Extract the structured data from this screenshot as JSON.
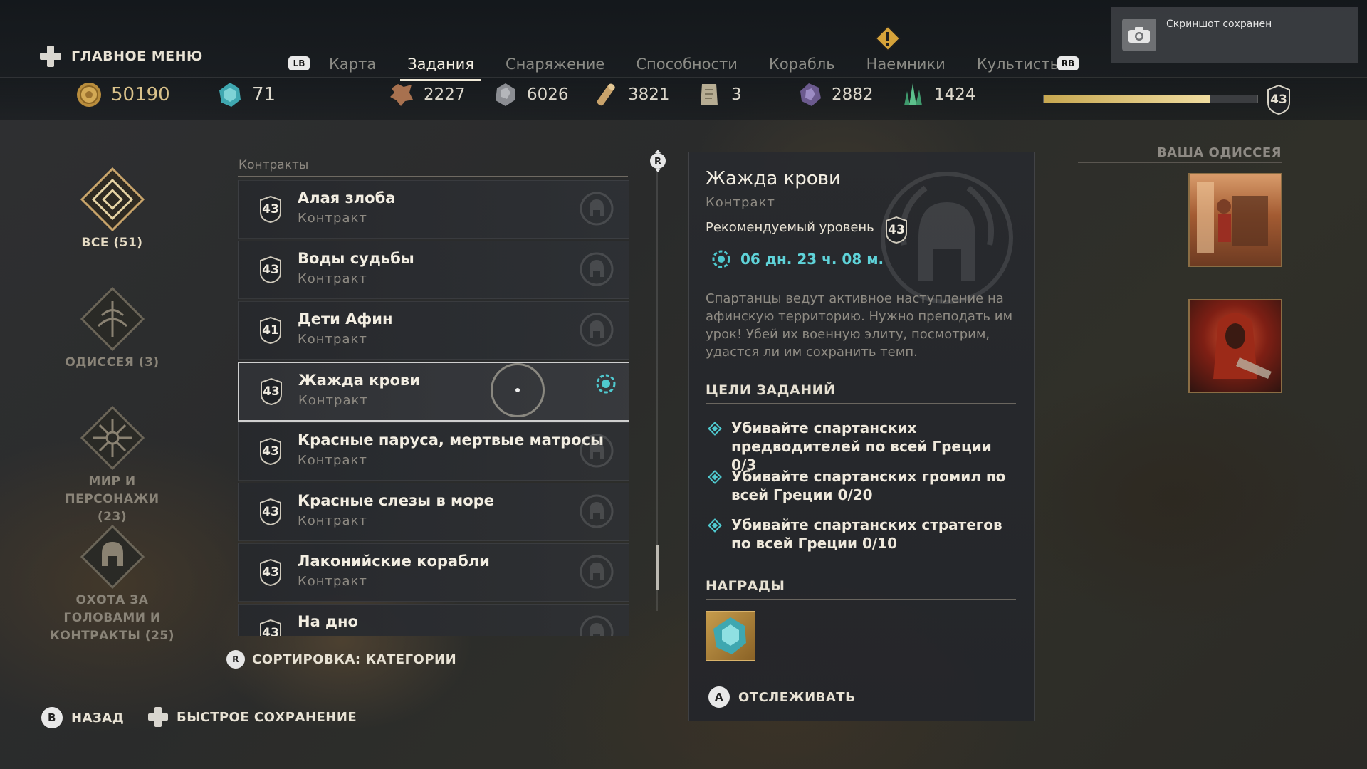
{
  "header": {
    "main_menu_label": "ГЛАВНОЕ МЕНЮ",
    "left_bumper": "LB",
    "right_bumper": "RB",
    "tabs": [
      {
        "label": "Карта",
        "active": false
      },
      {
        "label": "Задания",
        "active": true
      },
      {
        "label": "Снаряжение",
        "active": false
      },
      {
        "label": "Способности",
        "active": false
      },
      {
        "label": "Корабль",
        "active": false
      },
      {
        "label": "Наемники",
        "active": false
      },
      {
        "label": "Культисты",
        "active": false
      }
    ]
  },
  "resources": {
    "drachmae": "50190",
    "orichalcum": "71",
    "leather": "2227",
    "iron_ore": "6026",
    "wood": "3821",
    "ancient_tablets": "3",
    "obsidian": "2882",
    "crystals": "1424",
    "xp_progress": 0.78,
    "player_level": "43"
  },
  "toast": {
    "text": "Скриншот сохранен"
  },
  "categories": [
    {
      "label": "ВСЕ (51)",
      "active": true,
      "icon": "all-quests-icon"
    },
    {
      "label": "ОДИССЕЯ (3)",
      "active": false,
      "icon": "odyssey-icon"
    },
    {
      "label": "МИР И ПЕРСОНАЖИ (23)",
      "active": false,
      "icon": "world-icon"
    },
    {
      "label": "ОХОТА ЗА ГОЛОВАМИ И КОНТРАКТЫ (25)",
      "active": false,
      "icon": "bounty-icon"
    }
  ],
  "quest_list": {
    "header": "Контракты",
    "items": [
      {
        "level": "43",
        "name": "Алая злоба",
        "type": "Контракт",
        "selected": false
      },
      {
        "level": "43",
        "name": "Воды судьбы",
        "type": "Контракт",
        "selected": false
      },
      {
        "level": "41",
        "name": "Дети Афин",
        "type": "Контракт",
        "selected": false
      },
      {
        "level": "43",
        "name": "Жажда крови",
        "type": "Контракт",
        "selected": true
      },
      {
        "level": "43",
        "name": "Красные паруса, мертвые матросы",
        "type": "Контракт",
        "selected": false
      },
      {
        "level": "43",
        "name": "Красные слезы в море",
        "type": "Контракт",
        "selected": false
      },
      {
        "level": "43",
        "name": "Лаконийские корабли",
        "type": "Контракт",
        "selected": false
      },
      {
        "level": "43",
        "name": "На дно",
        "type": "",
        "selected": false
      }
    ],
    "sort_button": "R",
    "sort_label": "СОРТИРОВКА: КАТЕГОРИИ"
  },
  "detail": {
    "title": "Жажда крови",
    "type": "Контракт",
    "recommended_label": "Рекомендуемый уровень",
    "recommended_level": "43",
    "timer": "06 дн. 23 ч. 08 м.",
    "description": "Спартанцы ведут активное наступление на афинскую территорию. Нужно преподать им урок! Убей их военную элиту, посмотрим, удастся ли им сохранить темп.",
    "objectives_header": "ЦЕЛИ ЗАДАНИЙ",
    "objectives": [
      "Убивайте спартанских предводителей по всей Греции 0/3",
      "Убивайте спартанских громил по всей Греции 0/20",
      "Убивайте спартанских стратегов по всей Греции 0/10"
    ],
    "rewards_header": "НАГРАДЫ",
    "reward_icon": "orichalcum-icon",
    "track_button": "A",
    "track_label": "ОТСЛЕЖИВАТЬ"
  },
  "odyssey": {
    "header": "ВАША ОДИССЕЯ"
  },
  "footer": {
    "back_button": "B",
    "back_label": "НАЗАД",
    "quicksave_label": "БЫСТРОЕ СОХРАНЕНИЕ"
  },
  "colors": {
    "accent_teal": "#4fc9cf",
    "gold": "#c7a750"
  }
}
